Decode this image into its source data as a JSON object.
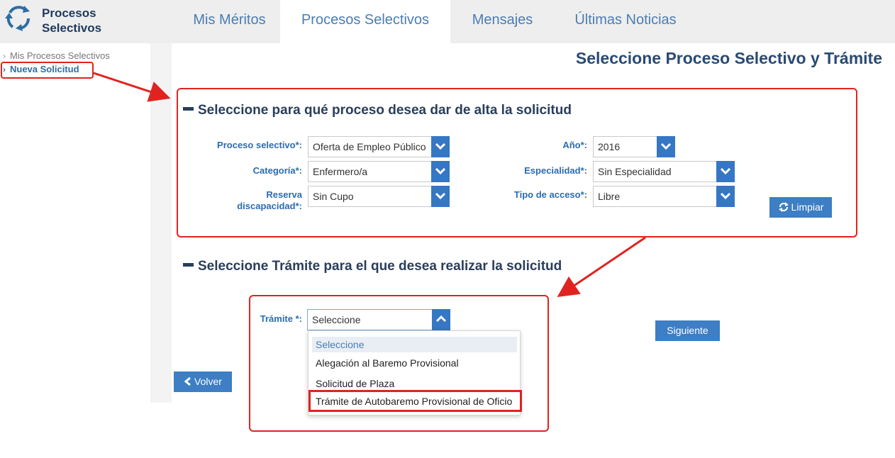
{
  "app": {
    "title_line1": "Procesos",
    "title_line2": "Selectivos"
  },
  "nav": {
    "tabs": [
      {
        "label": "Mis Méritos"
      },
      {
        "label": "Procesos Selectivos"
      },
      {
        "label": "Mensajes"
      },
      {
        "label": "Últimas Noticias"
      }
    ],
    "active": "Procesos Selectivos"
  },
  "sidebar": {
    "items": [
      {
        "label": "Mis Procesos Selectivos"
      },
      {
        "label": "Nueva Solicitud"
      }
    ]
  },
  "page": {
    "title": "Seleccione Proceso Selectivo y Trámite"
  },
  "section1": {
    "title": "Seleccione para qué proceso desea dar de alta la solicitud",
    "fields": {
      "proceso": {
        "label": "Proceso selectivo*:",
        "value": "Oferta de Empleo Público"
      },
      "categoria": {
        "label": "Categoría*:",
        "value": "Enfermero/a"
      },
      "reserva": {
        "label_line1": "Reserva",
        "label_line2": "discapacidad*:",
        "value": "Sin Cupo"
      },
      "anio": {
        "label": "Año*:",
        "value": "2016"
      },
      "especialidad": {
        "label": "Especialidad*:",
        "value": "Sin Especialidad"
      },
      "acceso": {
        "label": "Tipo de acceso*:",
        "value": "Libre"
      }
    },
    "limpiar_label": "Limpiar"
  },
  "section2": {
    "title": "Seleccione Trámite para el que desea realizar la solicitud",
    "tramite": {
      "label": "Trámite *:",
      "value": "Seleccione",
      "options": [
        "Seleccione",
        "Alegación al Baremo Provisional",
        "Solicitud de Plaza",
        "Trámite de Autobaremo Provisional de Oficio"
      ]
    },
    "siguiente_label": "Siguiente",
    "volver_label": "Volver"
  },
  "colors": {
    "accent": "#3577c4",
    "annotation_red": "#e0231f",
    "title_navy": "#2a4a72"
  }
}
